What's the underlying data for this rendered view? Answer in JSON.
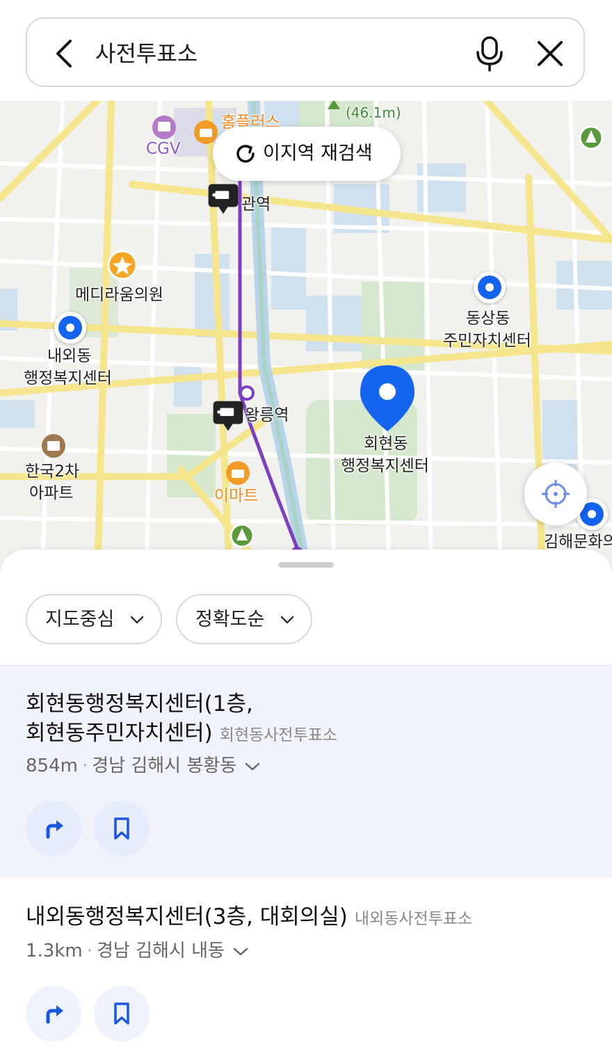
{
  "search": {
    "query": "사전투표소",
    "back_icon": "chevron-left-icon",
    "mic_icon": "microphone-icon",
    "clear_icon": "close-icon"
  },
  "map": {
    "rescan_label": "이지역 재검색",
    "labels": {
      "cgv": "CGV",
      "homeplus": "홈플러스",
      "mountain_height": "(46.1m)",
      "station_top": "관역",
      "station_mid": "왕릉역",
      "clinic": "메디라움의원",
      "naeoe_1": "내외동",
      "naeoe_2": "행정복지센터",
      "dongsang_1": "동상동",
      "dongsang_2": "주민자치센터",
      "hoehyeon_1": "회현동",
      "hoehyeon_2": "행정복지센터",
      "apt_1": "한국2차",
      "apt_2": "아파트",
      "emart": "이마트",
      "gimhae": "김해문화의"
    },
    "colors": {
      "poi_blue": "#1464f0",
      "road_yellow": "#f5e58c",
      "park_green": "#d5e8cd",
      "water_blue": "#cfe0ee"
    }
  },
  "filters": [
    {
      "label": "지도중심"
    },
    {
      "label": "정확도순"
    }
  ],
  "results": [
    {
      "title_line1": "회현동행정복지센터(1층,",
      "title_line2": "회현동주민자치센터)",
      "category": "회현동사전투표소",
      "distance": "854m",
      "address": "경남 김해시 봉황동"
    },
    {
      "title_line1": "내외동행정복지센터(3층, 대회의실)",
      "category": "내외동사전투표소",
      "distance": "1.3km",
      "address": "경남 김해시 내동"
    }
  ]
}
